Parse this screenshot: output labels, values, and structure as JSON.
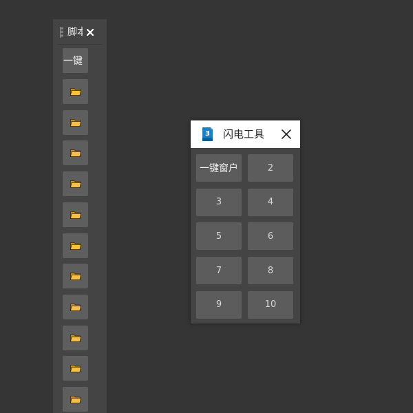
{
  "toolbar": {
    "title": "脚本",
    "first_button_label": "一键",
    "folder_button_count": 11,
    "folder_icon": "folder-icon"
  },
  "panel": {
    "title": "闪电工具",
    "app_icon": "3ds-max-icon",
    "app_icon_text": "3",
    "close_icon": "close-icon",
    "buttons": [
      {
        "label": "一键窗户"
      },
      {
        "label": "2"
      },
      {
        "label": "3"
      },
      {
        "label": "4"
      },
      {
        "label": "5"
      },
      {
        "label": "6"
      },
      {
        "label": "7"
      },
      {
        "label": "8"
      },
      {
        "label": "9"
      },
      {
        "label": "10"
      }
    ]
  },
  "colors": {
    "background": "#353535",
    "panel": "#444444",
    "button": "#5c5c5c",
    "folder_fill": "#f5c04a",
    "app_icon_blue": "#1e7fc1"
  }
}
